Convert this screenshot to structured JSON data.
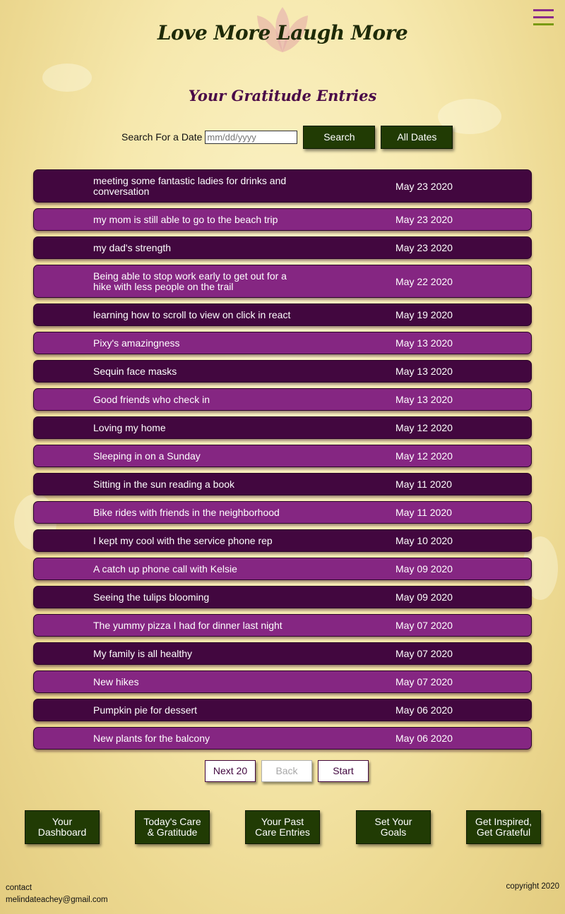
{
  "header": {
    "brand": "Love More Laugh More",
    "menu_icon": "hamburger-menu-icon"
  },
  "page_title": "Your Gratitude Entries",
  "search": {
    "label": "Search For a Date",
    "placeholder": "mm/dd/yyyy",
    "search_button": "Search",
    "all_dates_button": "All Dates"
  },
  "entries": [
    {
      "text": "meeting some fantastic ladies for drinks and conversation",
      "date": "May 23 2020"
    },
    {
      "text": "my mom is still able to go to the beach trip",
      "date": "May 23 2020"
    },
    {
      "text": "my dad's strength",
      "date": "May 23 2020"
    },
    {
      "text": "Being able to stop work early to get out for a hike with less people on the trail",
      "date": "May 22 2020"
    },
    {
      "text": "learning how to scroll to view on click in react",
      "date": "May 19 2020"
    },
    {
      "text": "Pixy's amazingness",
      "date": "May 13 2020"
    },
    {
      "text": "Sequin face masks",
      "date": "May 13 2020"
    },
    {
      "text": "Good friends who check in",
      "date": "May 13 2020"
    },
    {
      "text": "Loving my home",
      "date": "May 12 2020"
    },
    {
      "text": "Sleeping in on a Sunday",
      "date": "May 12 2020"
    },
    {
      "text": "Sitting in the sun reading a book",
      "date": "May 11 2020"
    },
    {
      "text": "Bike rides with friends in the neighborhood",
      "date": "May 11 2020"
    },
    {
      "text": "I kept my cool with the service phone rep",
      "date": "May 10 2020"
    },
    {
      "text": "A catch up phone call with Kelsie",
      "date": "May 09 2020"
    },
    {
      "text": "Seeing the tulips blooming",
      "date": "May 09 2020"
    },
    {
      "text": "The yummy pizza I had for dinner last night",
      "date": "May 07 2020"
    },
    {
      "text": "My family is all healthy",
      "date": "May 07 2020"
    },
    {
      "text": "New hikes",
      "date": "May 07 2020"
    },
    {
      "text": "Pumpkin pie for dessert",
      "date": "May 06 2020"
    },
    {
      "text": "New plants for the balcony",
      "date": "May 06 2020"
    }
  ],
  "pager": {
    "next": "Next 20",
    "back": "Back",
    "start": "Start"
  },
  "bottom_nav": [
    "Your Dashboard",
    "Today's Care & Gratitude",
    "Your Past Care Entries",
    "Set Your Goals",
    "Get Inspired, Get Grateful"
  ],
  "footer": {
    "contact_label": "contact",
    "email": "melindateachey@gmail.com",
    "copyright": "copyright 2020"
  },
  "colors": {
    "entry_dark": "#42073f",
    "entry_light": "#852682",
    "button_green": "#213b04",
    "title_purple": "#4a0a48"
  }
}
